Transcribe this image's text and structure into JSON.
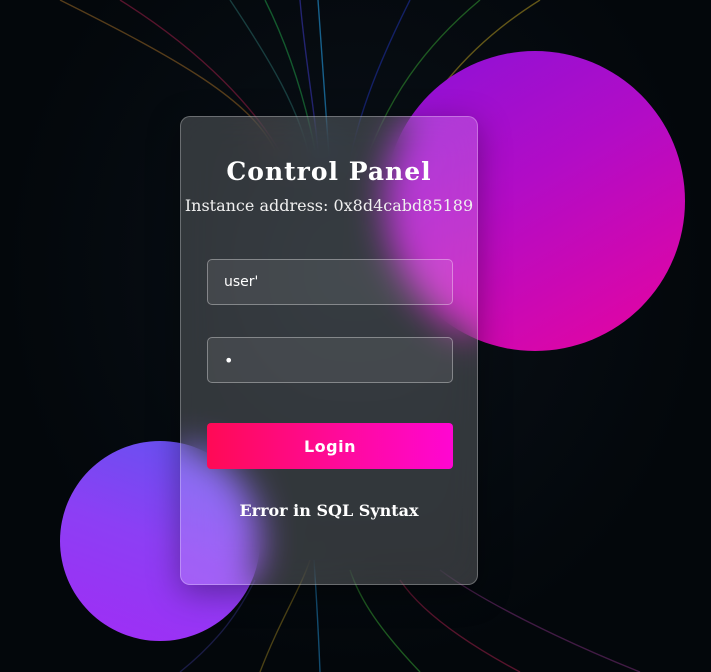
{
  "panel": {
    "title": "Control Panel",
    "subtitle": "Instance address: 0x8d4cabd85189"
  },
  "form": {
    "username_value": "user'",
    "password_value": "•",
    "login_label": "Login",
    "error_text": "Error in SQL Syntax"
  },
  "colors": {
    "background": "#03070b",
    "orb_pink": "#e206a6",
    "orb_violet": "#8c3ff4",
    "button_start": "#ff0a55",
    "button_end": "#ff06d2"
  }
}
